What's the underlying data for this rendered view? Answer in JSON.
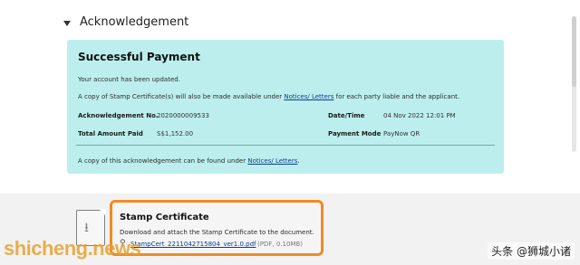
{
  "section": {
    "title": "Acknowledgement"
  },
  "panel": {
    "title": "Successful Payment",
    "line1": "Your account has been updated.",
    "line2_prefix": "A copy of Stamp Certificate(s) will also be made available under ",
    "line2_link": "Notices/ Letters",
    "line2_suffix": " for each party liable and the applicant.",
    "ack_no_label": "Acknowledgement No.",
    "ack_no_value": "2020000009533",
    "date_label": "Date/Time",
    "date_value": "04 Nov 2022 12:01 PM",
    "total_label": "Total Amount Paid",
    "total_value": "S$1,152.00",
    "mode_label": "Payment Mode",
    "mode_value": "PayNow QR",
    "line3_prefix": "A copy of this acknowledgement can be found under ",
    "line3_link": "Notices/ Letters",
    "line3_suffix": "."
  },
  "stamp": {
    "title": "Stamp Certificate",
    "description": "Download and attach the Stamp Certificate to the document.",
    "file_link": "StampCert_2211042715804_ver1.0.pdf",
    "file_meta": "(PDF, 0.10MB)",
    "highlight_color": "#ef8b23"
  },
  "watermarks": {
    "left": "shicheng.news",
    "right": "头条 @狮城小诸"
  },
  "icons": [
    "chevron-down-icon",
    "document-download-icon",
    "paperclip-icon"
  ]
}
